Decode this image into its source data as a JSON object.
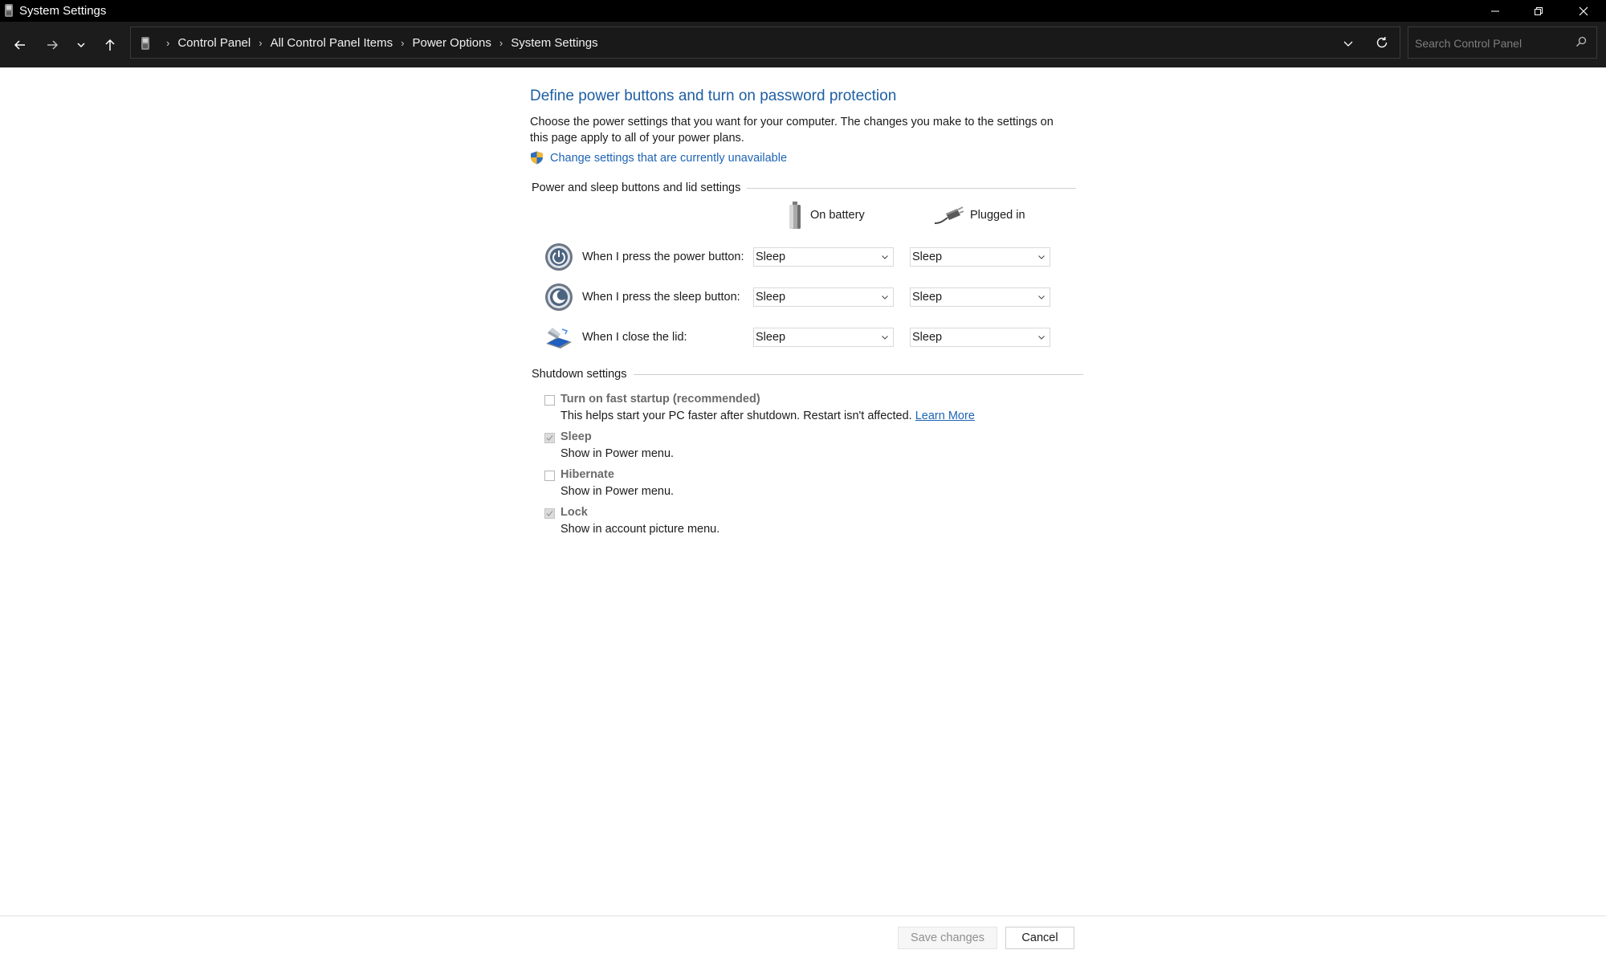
{
  "window": {
    "title": "System Settings",
    "icons": {
      "app": "power-options-icon",
      "minimize": "minimize-icon",
      "restore": "restore-icon",
      "close": "close-icon"
    }
  },
  "nav": {
    "icons": {
      "back": "arrow-left-icon",
      "forward": "arrow-right-icon",
      "recent": "chevron-down-icon",
      "up": "arrow-up-icon"
    },
    "breadcrumbs": [
      "Control Panel",
      "All Control Panel Items",
      "Power Options",
      "System Settings"
    ],
    "search_placeholder": "Search Control Panel"
  },
  "main": {
    "title": "Define power buttons and turn on password protection",
    "description": "Choose the power settings that you want for your computer. The changes you make to the settings on this page apply to all of your power plans.",
    "change_link": "Change settings that are currently unavailable",
    "buttons_section": {
      "heading": "Power and sleep buttons and lid settings",
      "columns": [
        "On battery",
        "Plugged in"
      ],
      "rows": [
        {
          "icon": "power-button-icon",
          "label": "When I press the power button:",
          "on_battery": "Sleep",
          "plugged_in": "Sleep"
        },
        {
          "icon": "sleep-button-icon",
          "label": "When I press the sleep button:",
          "on_battery": "Sleep",
          "plugged_in": "Sleep"
        },
        {
          "icon": "laptop-lid-icon",
          "label": "When I close the lid:",
          "on_battery": "Sleep",
          "plugged_in": "Sleep"
        }
      ]
    },
    "shutdown_section": {
      "heading": "Shutdown settings",
      "items": [
        {
          "title": "Turn on fast startup (recommended)",
          "description": "This helps start your PC faster after shutdown. Restart isn't affected.",
          "link": "Learn More",
          "checked": false
        },
        {
          "title": "Sleep",
          "description": "Show in Power menu.",
          "checked": true
        },
        {
          "title": "Hibernate",
          "description": "Show in Power menu.",
          "checked": false
        },
        {
          "title": "Lock",
          "description": "Show in account picture menu.",
          "checked": true
        }
      ]
    }
  },
  "footer": {
    "save_label": "Save changes",
    "cancel_label": "Cancel"
  },
  "colors": {
    "link": "#1e64b4",
    "title": "#1e5fa3",
    "titlebar": "#000000",
    "addressbar": "#1c1c1c"
  }
}
